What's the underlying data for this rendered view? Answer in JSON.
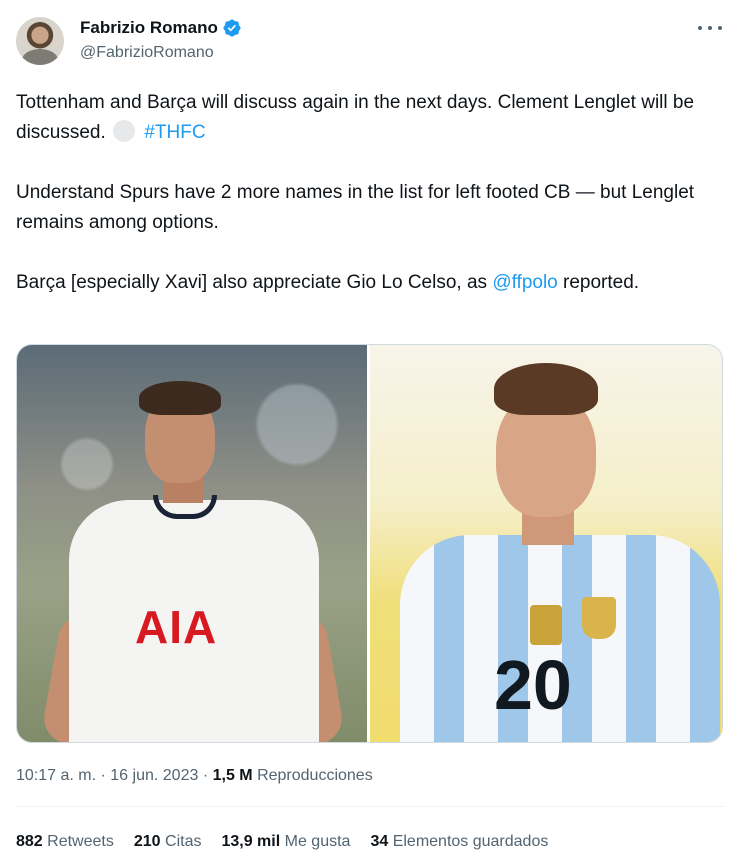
{
  "author": {
    "display_name": "Fabrizio Romano",
    "handle": "@FabrizioRomano",
    "verified_icon": "verified-badge-icon",
    "verified_color": "#1d9bf0"
  },
  "tweet": {
    "p1_text": "Tottenham and Barça will discuss again in the next days. Clement Lenglet will be discussed.",
    "p1_hashtag": "#THFC",
    "p2_text": "Understand Spurs have 2 more names in the list for left footed CB — but Lenglet remains among options.",
    "p3_text_before": "Barça [especially Xavi] also appreciate Gio Lo Celso, as",
    "p3_mention": "@ffpolo",
    "p3_text_after": "reported."
  },
  "media": {
    "left_photo": {
      "shirt_sponsor": "AIA"
    },
    "right_photo": {
      "shirt_number": "20"
    }
  },
  "meta": {
    "time": "10:17 a. m.",
    "date": "16 jun. 2023",
    "views_count": "1,5 M",
    "views_label": "Reproducciones"
  },
  "stats": {
    "retweets_count": "882",
    "retweets_label": "Retweets",
    "quotes_count": "210",
    "quotes_label": "Citas",
    "likes_count": "13,9 mil",
    "likes_label": "Me gusta",
    "bookmarks_count": "34",
    "bookmarks_label": "Elementos guardados"
  },
  "colors": {
    "link": "#1d9bf0",
    "secondary_text": "#536471",
    "primary_text": "#0f1419"
  }
}
